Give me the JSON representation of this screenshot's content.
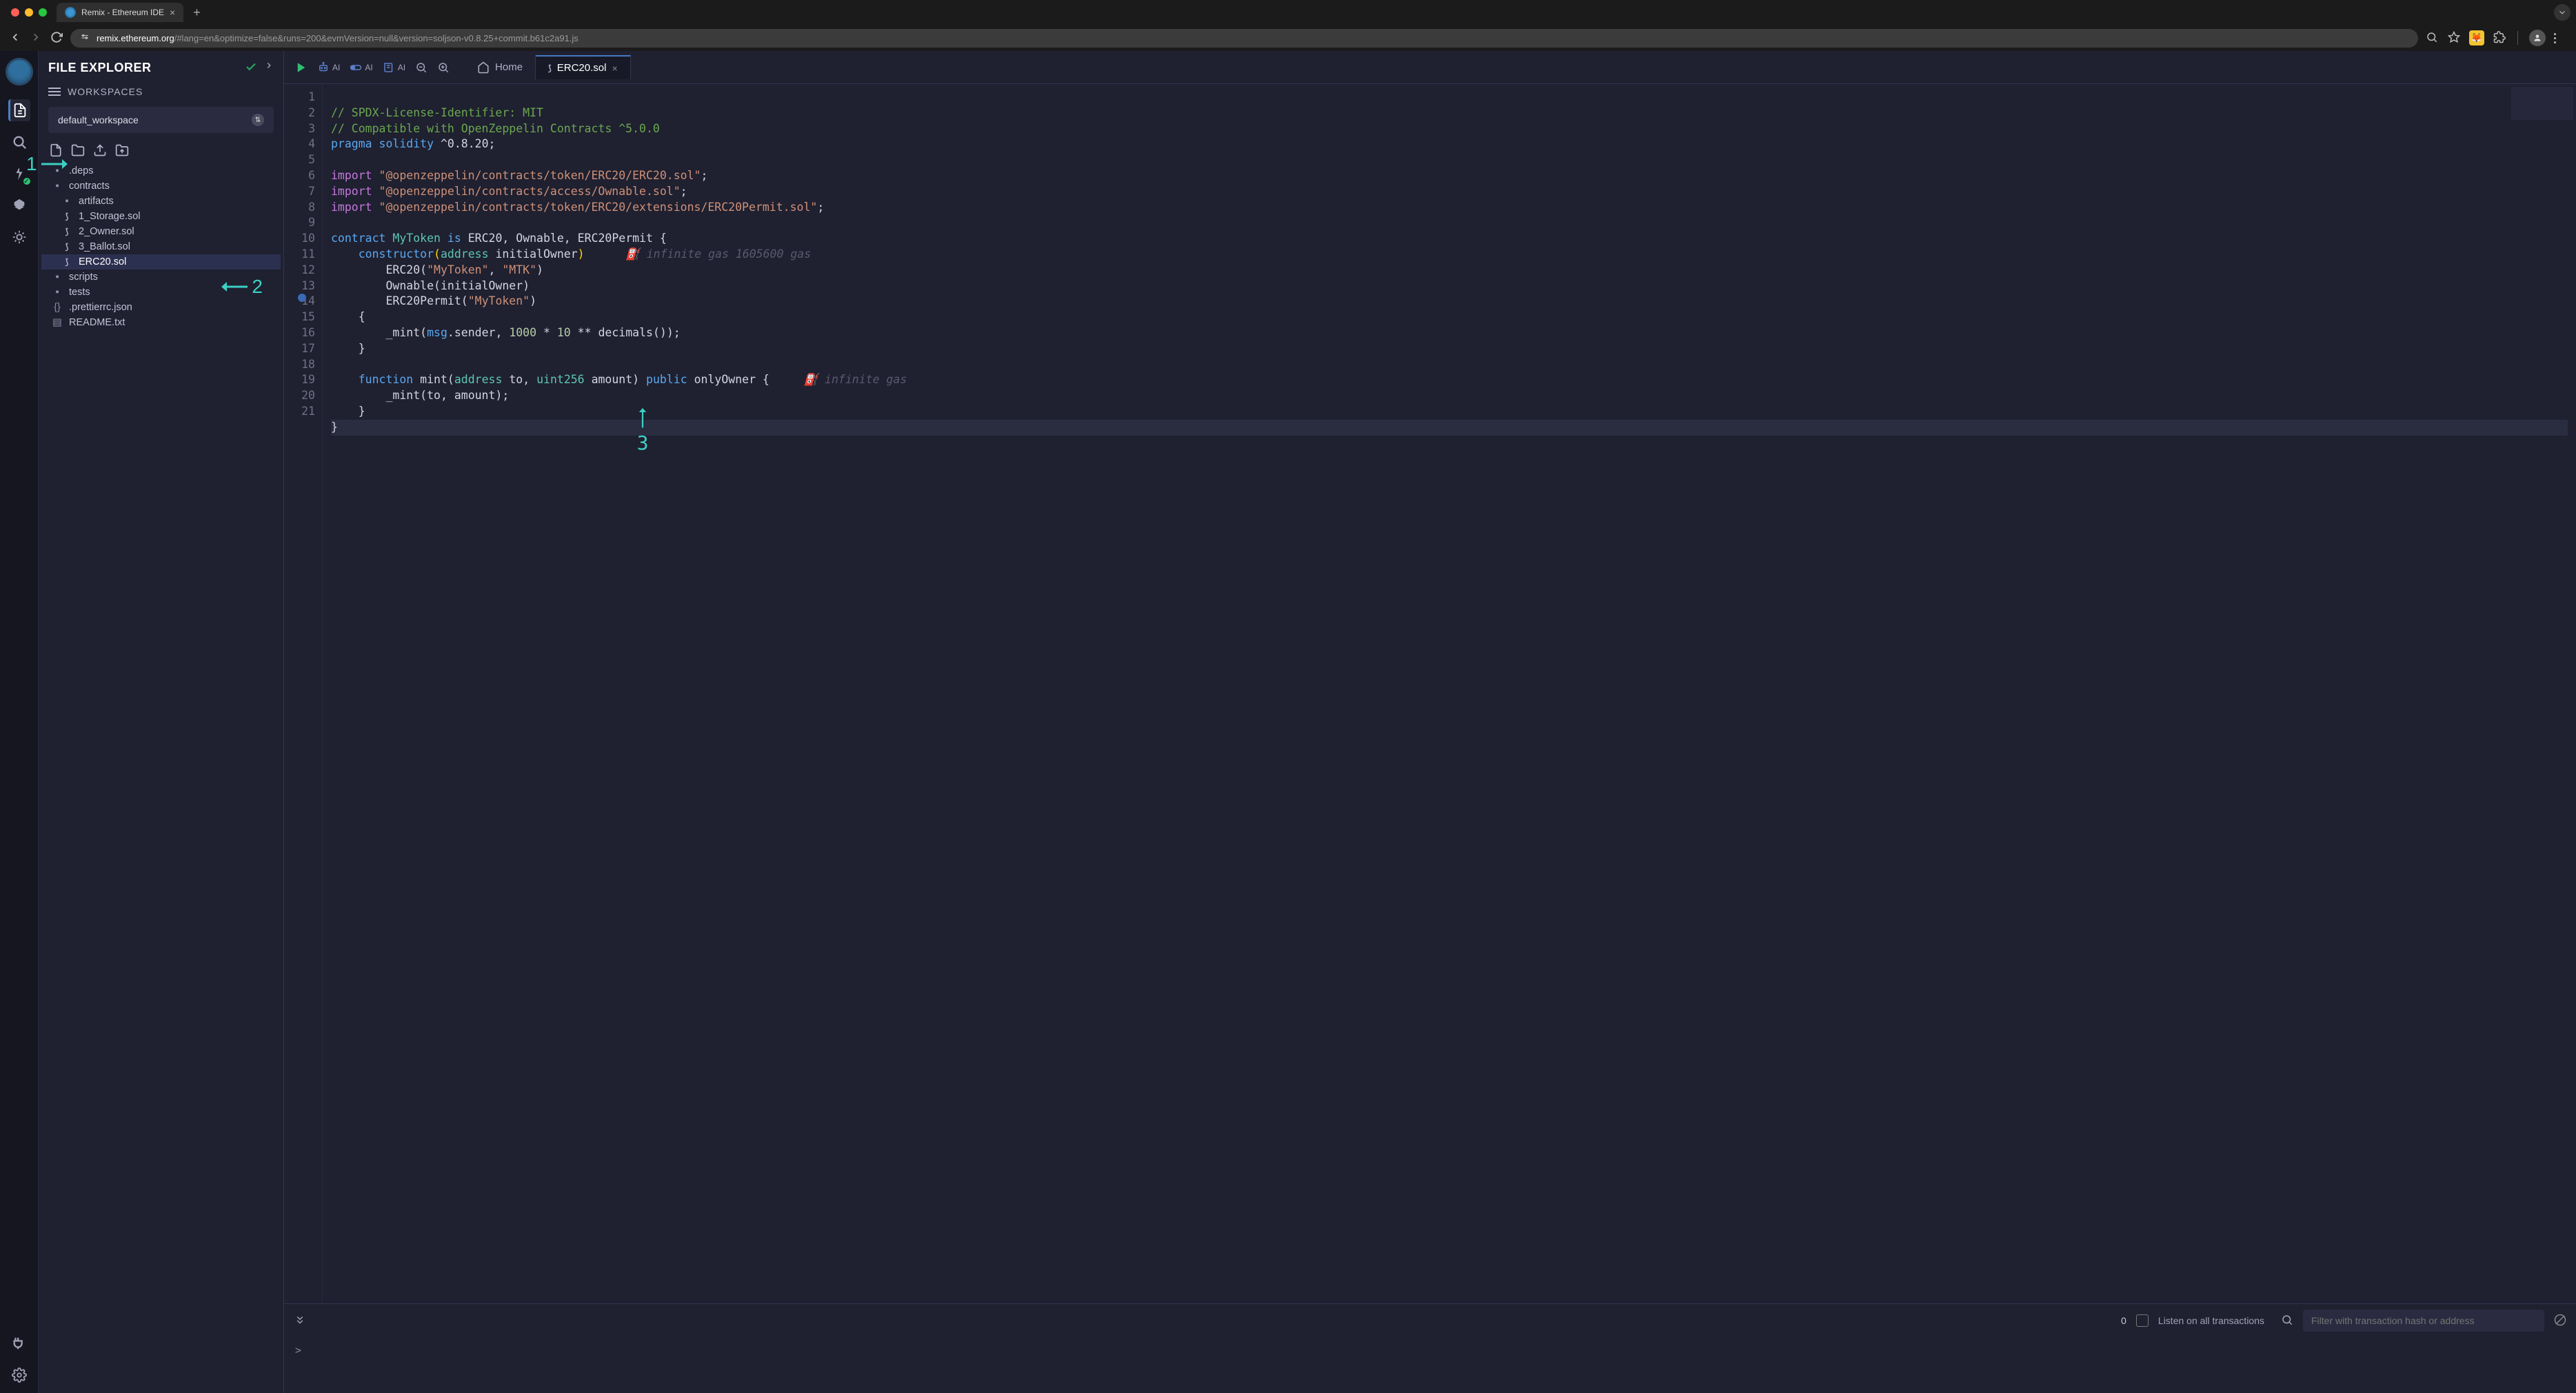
{
  "browser": {
    "tab_title": "Remix - Ethereum IDE",
    "url_domain": "remix.ethereum.org",
    "url_path": "/#lang=en&optimize=false&runs=200&evmVersion=null&version=soljson-v0.8.25+commit.b61c2a91.js"
  },
  "panel": {
    "title": "FILE EXPLORER",
    "workspaces_label": "WORKSPACES",
    "workspace_selected": "default_workspace"
  },
  "tree": {
    "deps": ".deps",
    "contracts": "contracts",
    "artifacts": "artifacts",
    "storage": "1_Storage.sol",
    "owner": "2_Owner.sol",
    "ballot": "3_Ballot.sol",
    "erc20": "ERC20.sol",
    "scripts": "scripts",
    "tests": "tests",
    "prettierrc": ".prettierrc.json",
    "readme": "README.txt"
  },
  "toolbar": {
    "ai": "AI"
  },
  "tabs": {
    "home": "Home",
    "erc20": "ERC20.sol"
  },
  "code": {
    "l1": "// SPDX-License-Identifier: MIT",
    "l2": "// Compatible with OpenZeppelin Contracts ^5.0.0",
    "l3_a": "pragma",
    "l3_b": "solidity",
    "l3_c": "^0.8.20;",
    "l5_a": "import",
    "l5_b": "\"@openzeppelin/contracts/token/ERC20/ERC20.sol\"",
    "l6_b": "\"@openzeppelin/contracts/access/Ownable.sol\"",
    "l7_b": "\"@openzeppelin/contracts/token/ERC20/extensions/ERC20Permit.sol\"",
    "l9_a": "contract",
    "l9_b": "MyToken",
    "l9_c": "is",
    "l9_d": "ERC20, Ownable, ERC20Permit {",
    "l10_a": "constructor",
    "l10_b": "address",
    "l10_c": "initialOwner",
    "hint9": "infinite gas 1605600 gas",
    "l11_a": "ERC20(",
    "l11_b": "\"MyToken\"",
    "l11_c": ", ",
    "l11_d": "\"MTK\"",
    "l11_e": ")",
    "l12_a": "Ownable(initialOwner)",
    "l13_a": "ERC20Permit(",
    "l13_b": "\"MyToken\"",
    "l13_c": ")",
    "l14": "{",
    "l15_a": "_mint(",
    "l15_b": "msg",
    "l15_c": ".sender, ",
    "l15_d": "1000",
    "l15_e": " * ",
    "l15_f": "10",
    "l15_g": " ** decimals());",
    "l16": "}",
    "l18_a": "function",
    "l18_b": "mint(",
    "l18_c": "address",
    "l18_d": "to, ",
    "l18_e": "uint256",
    "l18_f": "amount) ",
    "l18_g": "public",
    "l18_h": "onlyOwner {",
    "hint18": "infinite gas",
    "l19": "_mint(to, amount);",
    "l20": "}",
    "l21": "}"
  },
  "terminal": {
    "count": "0",
    "listen_label": "Listen on all transactions",
    "filter_placeholder": "Filter with transaction hash or address",
    "prompt": ">"
  },
  "annotations": {
    "a1": "1",
    "a2": "2",
    "a3": "3"
  }
}
